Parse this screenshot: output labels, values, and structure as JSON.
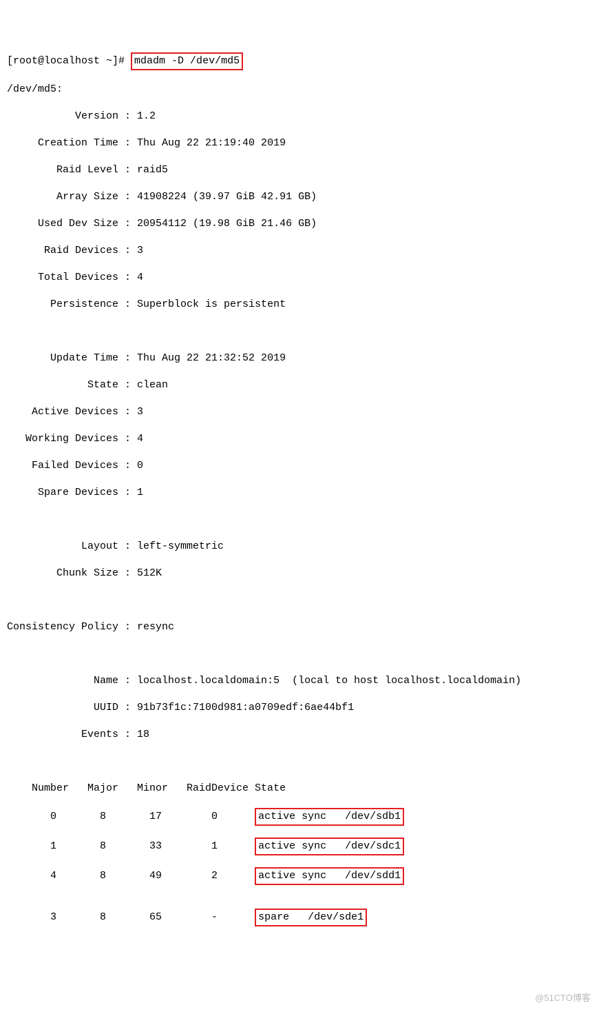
{
  "prompt": "[root@localhost ~]#",
  "command": "mdadm -D /dev/md5",
  "devline": "/dev/md5:",
  "fields": {
    "version_l": "           Version :",
    "version_v": " 1.2",
    "ctime_l": "     Creation Time :",
    "ctime_v": " Thu Aug 22 21:19:40 2019",
    "rlevel_l": "        Raid Level :",
    "rlevel_v": " raid5",
    "asize_l": "        Array Size :",
    "asize_v": " 41908224 (39.97 GiB 42.91 GB)",
    "usize_l": "     Used Dev Size :",
    "usize_v": " 20954112 (19.98 GiB 21.46 GB)",
    "rdev_l": "      Raid Devices :",
    "rdev_v": " 3",
    "tdev_l": "     Total Devices :",
    "tdev_v": " 4",
    "pers_l": "       Persistence :",
    "pers_v": " Superblock is persistent",
    "utime_l": "       Update Time :",
    "utime_v": " Thu Aug 22 21:32:52 2019",
    "state_l": "             State :",
    "state_v": " clean",
    "adev_l": "    Active Devices :",
    "adev_v": " 3",
    "wdev_l": "   Working Devices :",
    "wdev_v": " 4",
    "fdev_l": "    Failed Devices :",
    "fdev_v": " 0",
    "sdev_l": "     Spare Devices :",
    "sdev_v": " 1",
    "layout_l": "            Layout :",
    "layout_v": " left-symmetric",
    "chunk_l": "        Chunk Size :",
    "chunk_v": " 512K",
    "cpol_l": "Consistency Policy :",
    "cpol_v": " resync",
    "name_l": "              Name :",
    "name_v": " localhost.localdomain:5  (local to host localhost.localdomain)",
    "uuid_l": "              UUID :",
    "uuid_v": " 91b73f1c:7100d981:a0709edf:6ae44bf1",
    "events_l": "            Events :",
    "events_v": " 18"
  },
  "tbl_header": "    Number   Major   Minor   RaidDevice State",
  "rows": [
    "       0       8       17        0      ",
    "       1       8       33        1      ",
    "       4       8       49        2      ",
    "",
    "       3       8       65        -      "
  ],
  "states": [
    "active sync   /dev/sdb1",
    "active sync   /dev/sdc1",
    "active sync   /dev/sdd1",
    "spare   /dev/sde1"
  ],
  "watermark": "@51CTO博客"
}
